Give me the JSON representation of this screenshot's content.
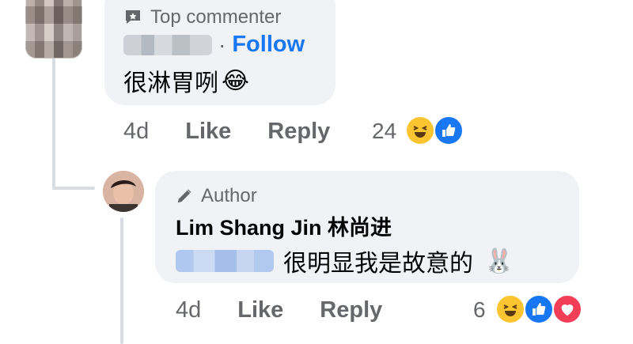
{
  "comment": {
    "badge": "Top commenter",
    "author_blurred": "Yi Fong",
    "separator": "·",
    "follow_label": "Follow",
    "text": "很淋胃咧",
    "text_emoji": "😂",
    "time": "4d",
    "like_label": "Like",
    "reply_label": "Reply",
    "reaction_count": "24",
    "reactions": [
      "laugh-reaction-icon",
      "like-reaction-icon"
    ]
  },
  "reply": {
    "badge": "Author",
    "author": "Lim Shang Jin 林尚进",
    "mention_blurred": "Yi Fong",
    "text": "很明显我是故意的",
    "text_emoji": "🐰",
    "time": "4d",
    "like_label": "Like",
    "reply_label": "Reply",
    "reaction_count": "6",
    "reactions": [
      "laugh-reaction-icon",
      "like-reaction-icon",
      "love-reaction-icon"
    ]
  },
  "colors": {
    "bubble": "#f0f2f5",
    "link": "#1877f2",
    "muted": "#65676b",
    "text": "#050505"
  }
}
